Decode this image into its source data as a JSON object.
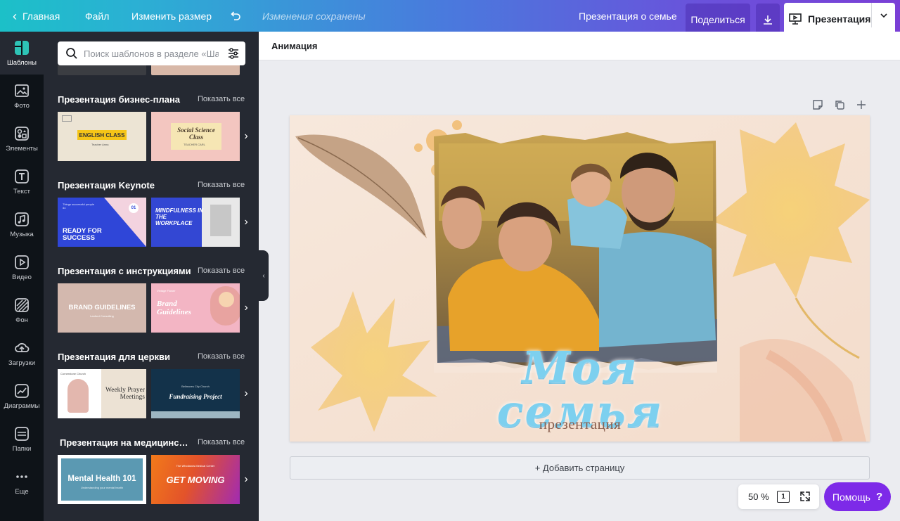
{
  "topbar": {
    "home": "Главная",
    "file": "Файл",
    "resize": "Изменить размер",
    "saved": "Изменения сохранены",
    "doc_title": "Презентация о семье",
    "share": "Поделиться",
    "present": "Презентация"
  },
  "rail": [
    {
      "label": "Шаблоны",
      "icon": "templates-icon"
    },
    {
      "label": "Фото",
      "icon": "photo-icon"
    },
    {
      "label": "Элементы",
      "icon": "elements-icon"
    },
    {
      "label": "Текст",
      "icon": "text-icon"
    },
    {
      "label": "Музыка",
      "icon": "music-icon"
    },
    {
      "label": "Видео",
      "icon": "video-icon"
    },
    {
      "label": "Фон",
      "icon": "background-icon"
    },
    {
      "label": "Загрузки",
      "icon": "upload-icon"
    },
    {
      "label": "Диаграммы",
      "icon": "charts-icon"
    },
    {
      "label": "Папки",
      "icon": "folder-icon"
    },
    {
      "label": "Еще",
      "icon": "more-icon"
    }
  ],
  "search": {
    "placeholder": "Поиск шаблонов в разделе «Шаблоны»"
  },
  "show_all": "Показать все",
  "sections": [
    {
      "title": "Презентация бизнес-плана",
      "thumbs": [
        {
          "text": "ENGLISH CLASS",
          "sub": "Teacher Anna",
          "bg": "#ece4d4",
          "accent": "#f5c518"
        },
        {
          "text": "Social Science Class",
          "sub": "TEACHER CARL",
          "bg": "#f3c6c0",
          "accent": "#f6e6b4"
        }
      ]
    },
    {
      "title": "Презентация Keynote",
      "thumbs": [
        {
          "text": "READY FOR SUCCESS",
          "sub": "Things successful people do",
          "badge": "01",
          "bg": "#2f46d8",
          "accent": "#f3d3df"
        },
        {
          "text": "MINDFULNESS IN THE WORKPLACE",
          "bg": "#3347d3",
          "accent": "#e8e8e8"
        }
      ]
    },
    {
      "title": "Презентация с инструкциями",
      "thumbs": [
        {
          "text": "BRAND GUIDELINES",
          "sub": "Lanford Consulting",
          "bg": "#d3b8ae",
          "accent": "#fff"
        },
        {
          "text": "Brand Guidelines",
          "sub": "Vintage Flower",
          "bg": "#f3b5c4",
          "accent": "#ffffff"
        }
      ]
    },
    {
      "title": "Презентация для церкви",
      "thumbs": [
        {
          "text": "Weekly Prayer Meetings",
          "sub": "Cornerstone Church",
          "bg": "#ece2d4",
          "accent": "#333"
        },
        {
          "text": "Fundraising Project",
          "sub": "Bellmores City Church",
          "bg": "#13324a",
          "accent": "#fff"
        }
      ]
    },
    {
      "title": "Презентация на медицинскую тему",
      "thumbs": [
        {
          "text": "Mental Health 101",
          "sub": "Understanding your mental health",
          "bg": "#5b99b2",
          "accent": "#fff"
        },
        {
          "text": "GET MOVING",
          "sub": "The Windlands Medical Center",
          "bg": "#e3532a",
          "accent": "#fff"
        }
      ]
    }
  ],
  "editor": {
    "animation": "Анимация",
    "slide_title": "Моя семья",
    "slide_subtitle": "презентация",
    "add_page": "+ Добавить страницу",
    "zoom": "50 %",
    "page_count": "1",
    "help": "Помощь"
  },
  "colors": {
    "accent_purple": "#7d2ae8",
    "rail_bg": "#0e1318",
    "panel_bg": "#252932",
    "slide_title": "#7dd0ef"
  }
}
